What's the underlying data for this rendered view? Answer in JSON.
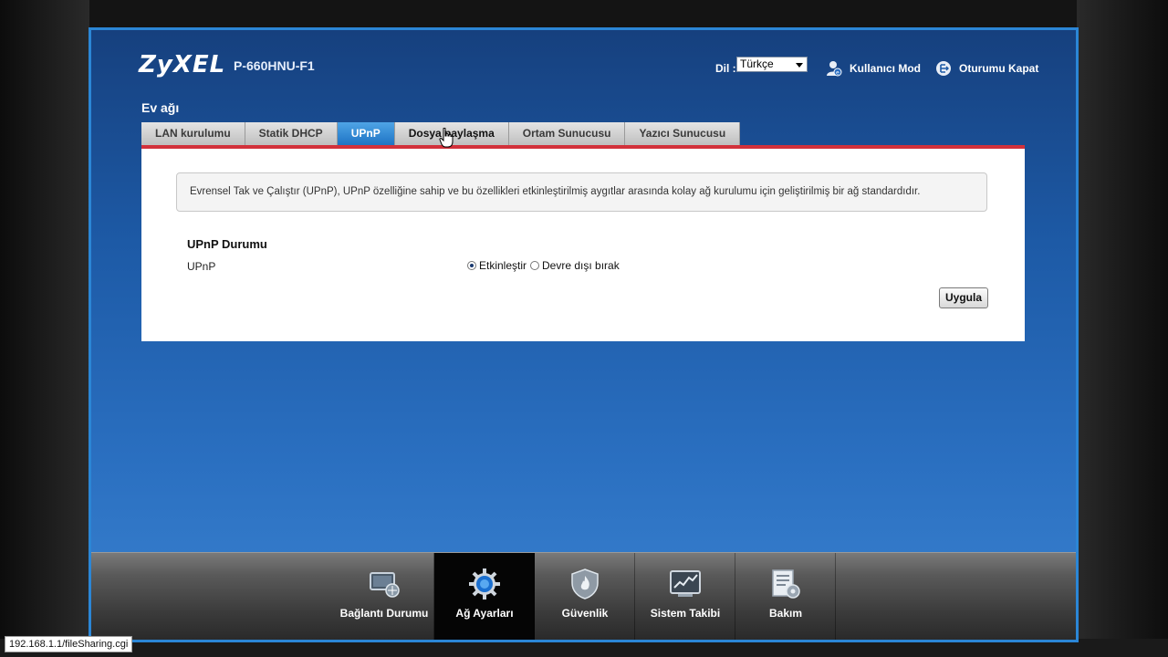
{
  "header": {
    "brand": "ZyXEL",
    "model": "P-660HNU-F1",
    "language_label": "Dil :",
    "language_value": "Türkçe",
    "user_mode_label": "Kullanıcı Mod",
    "logout_label": "Oturumu Kapat"
  },
  "page": {
    "section_title": "Ev ağı",
    "tabs": [
      {
        "label": "LAN kurulumu"
      },
      {
        "label": "Statik DHCP"
      },
      {
        "label": "UPnP"
      },
      {
        "label": "Dosya paylaşma"
      },
      {
        "label": "Ortam Sunucusu"
      },
      {
        "label": "Yazıcı Sunucusu"
      }
    ],
    "active_tab": "UPnP",
    "info_text": "Evrensel Tak ve Çalıştır (UPnP), UPnP özelliğine sahip ve bu özellikleri etkinleştirilmiş aygıtlar arasında kolay ağ kurulumu için geliştirilmiş bir ağ standardıdır.",
    "upnp_section_title": "UPnP Durumu",
    "upnp_field_label": "UPnP",
    "radio_enable_label": "Etkinleştir",
    "radio_disable_label": "Devre dışı bırak",
    "selected_option": "Etkinleştir",
    "apply_label": "Uygula"
  },
  "bottom_nav": {
    "items": [
      {
        "label": "Bağlantı Durumu",
        "icon": "connection-status-icon"
      },
      {
        "label": "Ağ Ayarları",
        "icon": "network-settings-gear-icon"
      },
      {
        "label": "Güvenlik",
        "icon": "security-shield-icon"
      },
      {
        "label": "Sistem Takibi",
        "icon": "system-monitor-icon"
      },
      {
        "label": "Bakım",
        "icon": "maintenance-icon"
      }
    ],
    "active": "Ağ Ayarları"
  },
  "status_bar": {
    "url": "192.168.1.1/fileSharing.cgi"
  },
  "colors": {
    "frame_border": "#2b86d6",
    "active_tab": "#1e74c4",
    "tab_underline": "#d2313b"
  }
}
